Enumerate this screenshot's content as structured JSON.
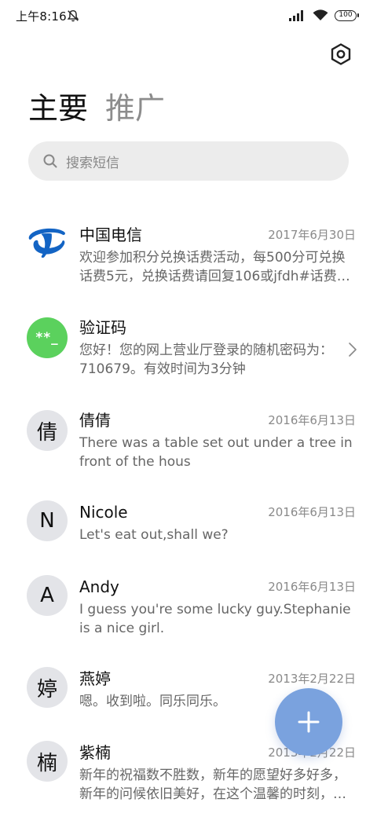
{
  "status_bar": {
    "time": "上午8:16",
    "battery": "100",
    "icons": [
      "mute-icon",
      "signal-icon",
      "wifi-icon",
      "battery-icon"
    ]
  },
  "header": {
    "tabs": [
      {
        "label": "主要",
        "active": true
      },
      {
        "label": "推广",
        "active": false
      }
    ],
    "settings_icon": "hexagon-settings-icon"
  },
  "search": {
    "placeholder": "搜索短信",
    "icon": "search-icon"
  },
  "conversations": [
    {
      "name": "中国电信",
      "date": "2017年6月30日",
      "preview": "欢迎参加积分兑换话费活动，每500分可兑换话费5元，兑换话费请回复106或jfdh#话费…",
      "avatar": "china-telecom-logo"
    },
    {
      "name": "验证码",
      "date": "",
      "preview": "您好！您的网上营业厅登录的随机密码为：710679。有效时间为3分钟",
      "avatar_text": "**_",
      "avatar_color": "#5bd15d"
    },
    {
      "name": "倩倩",
      "date": "2016年6月13日",
      "preview": "There was a table set out under a tree in front of the hous",
      "avatar_text": "倩"
    },
    {
      "name": "Nicole",
      "date": "2016年6月13日",
      "preview": "Let's eat out,shall we?",
      "avatar_text": "N"
    },
    {
      "name": "Andy",
      "date": "2016年6月13日",
      "preview": "I guess you're some lucky guy.Stephanie is a nice girl.",
      "avatar_text": "A"
    },
    {
      "name": "燕婷",
      "date": "2013年2月22日",
      "preview": "嗯。收到啦。同乐同乐。",
      "avatar_text": "婷"
    },
    {
      "name": "紫楠",
      "date": "2013年2月22日",
      "preview": "新年的祝福数不胜数，新年的愿望好多好多，新年的问候依旧美好，在这个温馨的时刻，…",
      "avatar_text": "楠"
    }
  ],
  "fab": {
    "icon": "plus-icon",
    "color": "#7aa2de"
  }
}
